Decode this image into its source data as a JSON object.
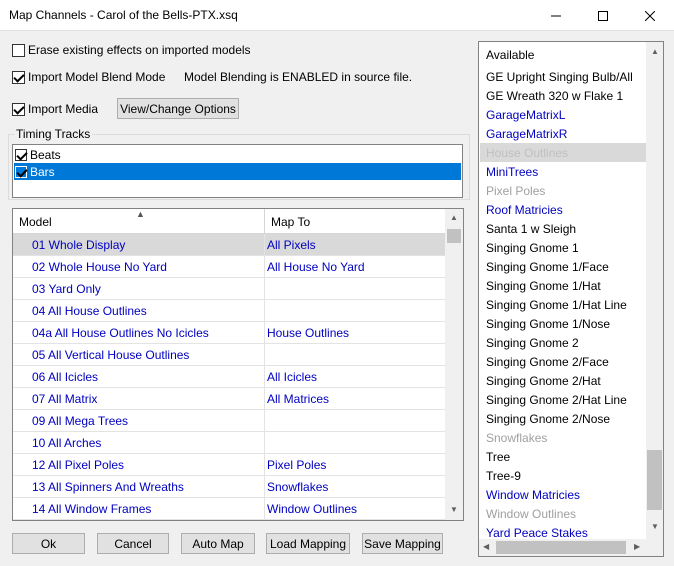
{
  "window": {
    "title": "Map Channels - Carol of the Bells-PTX.xsq"
  },
  "options": {
    "erase_label": "Erase existing effects on imported models",
    "erase_checked": false,
    "blend_label": "Import Model Blend Mode",
    "blend_checked": true,
    "blend_note": "Model Blending is ENABLED in source file.",
    "media_label": "Import Media",
    "media_checked": true,
    "media_button": "View/Change Options"
  },
  "timing": {
    "group_label": "Timing Tracks",
    "tracks": [
      {
        "label": "Beats",
        "checked": true,
        "selected": false
      },
      {
        "label": "Bars",
        "checked": true,
        "selected": true
      }
    ]
  },
  "grid": {
    "col_model": "Model",
    "col_map": "Map To",
    "rows": [
      {
        "model": "01 Whole Display",
        "map": "All Pixels",
        "selected": true
      },
      {
        "model": "02 Whole House No Yard",
        "map": "All House No Yard",
        "selected": false
      },
      {
        "model": "03 Yard Only",
        "map": "",
        "selected": false
      },
      {
        "model": "04 All House Outlines",
        "map": "",
        "selected": false
      },
      {
        "model": "04a All House Outlines No Icicles",
        "map": "House Outlines",
        "selected": false
      },
      {
        "model": "05 All Vertical House Outlines",
        "map": "",
        "selected": false
      },
      {
        "model": "06 All Icicles",
        "map": "All Icicles",
        "selected": false
      },
      {
        "model": "07 All Matrix",
        "map": "All Matrices",
        "selected": false
      },
      {
        "model": "09 All Mega Trees",
        "map": "",
        "selected": false
      },
      {
        "model": "10 All Arches",
        "map": "",
        "selected": false
      },
      {
        "model": "12 All Pixel Poles",
        "map": "Pixel Poles",
        "selected": false
      },
      {
        "model": "13 All Spinners And Wreaths",
        "map": "Snowflakes",
        "selected": false
      },
      {
        "model": "14 All Window Frames",
        "map": "Window Outlines",
        "selected": false
      }
    ]
  },
  "available": {
    "header": "Available",
    "items": [
      {
        "label": "GE Upright Singing Bulb/All",
        "style": "dark"
      },
      {
        "label": "GE Wreath 320 w Flake 1",
        "style": "dark"
      },
      {
        "label": "GarageMatrixL",
        "style": "blue"
      },
      {
        "label": "GarageMatrixR",
        "style": "blue"
      },
      {
        "label": "House Outlines",
        "style": "sel"
      },
      {
        "label": "MiniTrees",
        "style": "blue"
      },
      {
        "label": "Pixel Poles",
        "style": "gray"
      },
      {
        "label": "Roof Matricies",
        "style": "blue"
      },
      {
        "label": "Santa 1 w Sleigh",
        "style": "dark"
      },
      {
        "label": "Singing Gnome 1",
        "style": "dark"
      },
      {
        "label": "Singing Gnome 1/Face",
        "style": "dark"
      },
      {
        "label": "Singing Gnome 1/Hat",
        "style": "dark"
      },
      {
        "label": "Singing Gnome 1/Hat Line",
        "style": "dark"
      },
      {
        "label": "Singing Gnome 1/Nose",
        "style": "dark"
      },
      {
        "label": "Singing Gnome 2",
        "style": "dark"
      },
      {
        "label": "Singing Gnome 2/Face",
        "style": "dark"
      },
      {
        "label": "Singing Gnome 2/Hat",
        "style": "dark"
      },
      {
        "label": "Singing Gnome 2/Hat Line",
        "style": "dark"
      },
      {
        "label": "Singing Gnome 2/Nose",
        "style": "dark"
      },
      {
        "label": "Snowflakes",
        "style": "gray"
      },
      {
        "label": "Tree",
        "style": "dark"
      },
      {
        "label": "Tree-9",
        "style": "dark"
      },
      {
        "label": "Window Matricies",
        "style": "blue"
      },
      {
        "label": "Window Outlines",
        "style": "gray"
      },
      {
        "label": "Yard Peace Stakes",
        "style": "blue"
      }
    ]
  },
  "buttons": {
    "ok": "Ok",
    "cancel": "Cancel",
    "auto_map": "Auto Map",
    "load": "Load Mapping",
    "save": "Save Mapping"
  }
}
